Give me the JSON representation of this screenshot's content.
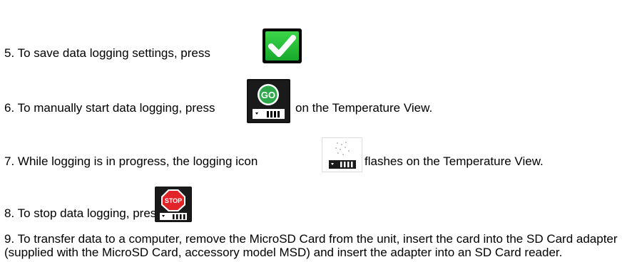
{
  "steps": {
    "step5": "5. To save data logging settings, press",
    "step6_before": "6. To manually start data logging, press",
    "step6_after": "on the Temperature View.",
    "step7_before": "7. While logging is in progress, the logging icon",
    "step7_after": "flashes on the Temperature View.",
    "step8": "8. To stop data logging, press",
    "step9": "9. To transfer data to a computer, remove the MicroSD Card from the unit, insert the card into the SD Card adapter (supplied with the MicroSD Card, accessory model MSD) and insert the adapter into an SD Card reader."
  },
  "icons": {
    "save": "checkmark-icon",
    "go": "go-logging-icon",
    "logging": "logging-icon",
    "stop": "stop-logging-icon",
    "go_label": "GO",
    "stop_label": "STOP"
  },
  "colors": {
    "check_green": "#22b534",
    "go_green": "#2ea84a",
    "stop_red": "#e0242a"
  }
}
